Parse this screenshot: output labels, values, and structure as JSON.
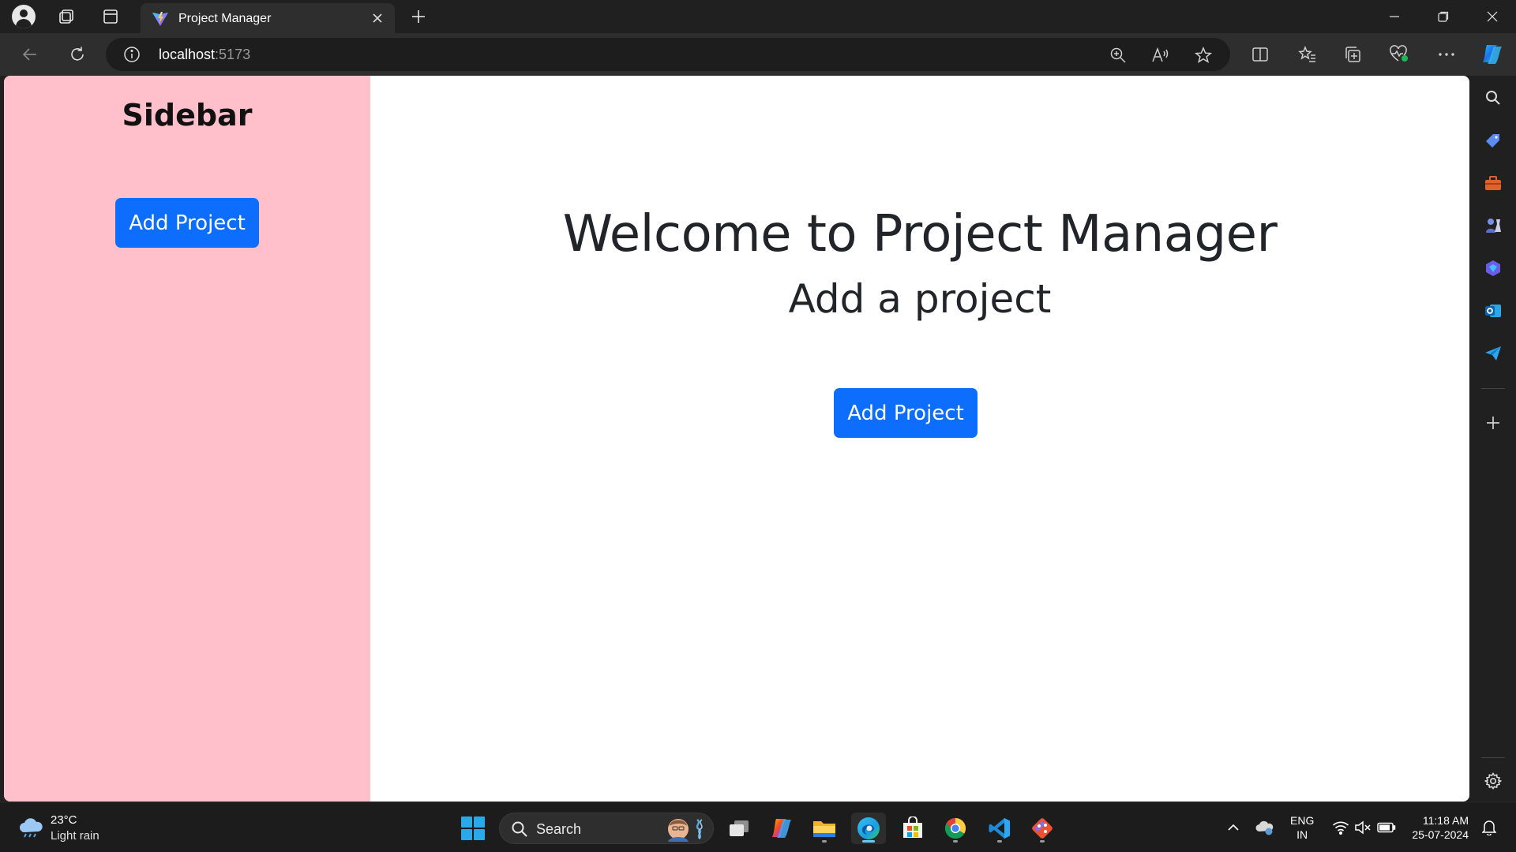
{
  "browser": {
    "tab_title": "Project Manager",
    "url_host": "localhost",
    "url_port": ":5173"
  },
  "app": {
    "sidebar": {
      "title": "Sidebar",
      "add_button": "Add Project",
      "background": "#ffc0cb"
    },
    "main": {
      "heading": "Welcome to Project Manager",
      "subheading": "Add a project",
      "add_button": "Add Project"
    },
    "accent": "#0d6efd"
  },
  "taskbar": {
    "weather_temp": "23°C",
    "weather_desc": "Light rain",
    "search_label": "Search",
    "lang_line1": "ENG",
    "lang_line2": "IN",
    "time": "11:18 AM",
    "date": "25-07-2024"
  }
}
